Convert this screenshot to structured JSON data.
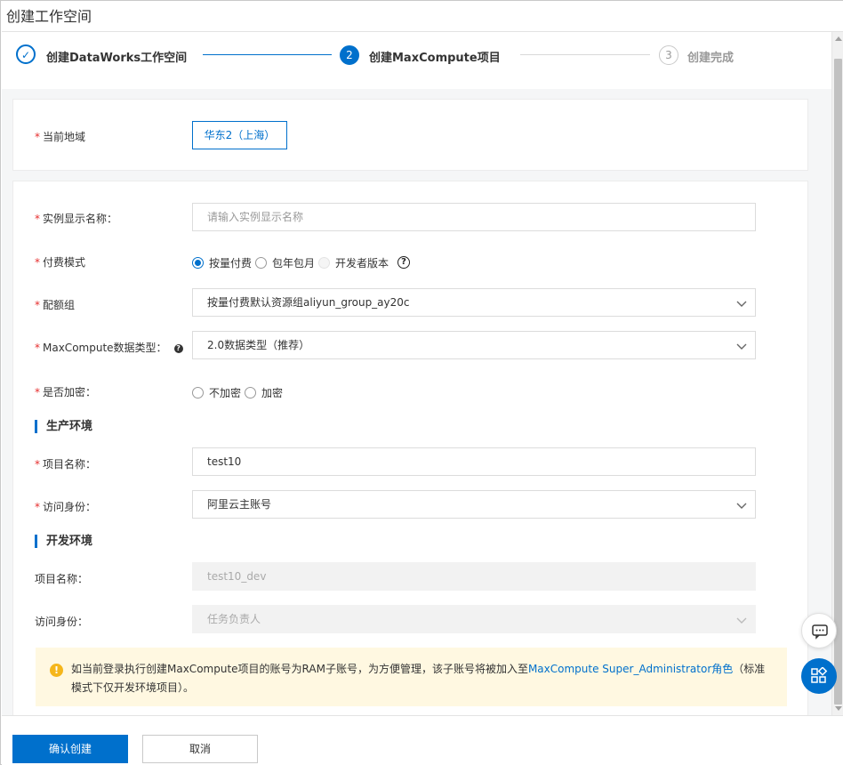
{
  "window": {
    "title": "创建工作空间"
  },
  "steps": [
    {
      "index": "✓",
      "label": "创建DataWorks工作空间",
      "state": "done"
    },
    {
      "index": "2",
      "label": "创建MaxCompute项目",
      "state": "active"
    },
    {
      "index": "3",
      "label": "创建完成",
      "state": "todo"
    }
  ],
  "region": {
    "label": "当前地域",
    "value": "华东2（上海）"
  },
  "form": {
    "instance_name": {
      "label": "实例显示名称：",
      "placeholder": "请输入实例显示名称"
    },
    "billing": {
      "label": "付费模式",
      "options": [
        "按量付费",
        "包年包月",
        "开发者版本"
      ],
      "selected": "按量付费",
      "help_icon": "question-circle-icon"
    },
    "quota_group": {
      "label": "配额组",
      "value": "按量付费默认资源组aliyun_group_ay20c"
    },
    "data_type": {
      "label": "MaxCompute数据类型：",
      "value": "2.0数据类型（推荐）",
      "help_icon": "question-filled-icon"
    },
    "encryption": {
      "label": "是否加密：",
      "options": [
        "不加密",
        "加密"
      ]
    }
  },
  "prod_env": {
    "title": "生产环境",
    "project_name": {
      "label": "项目名称：",
      "value": "test10"
    },
    "access_identity": {
      "label": "访问身份：",
      "value": "阿里云主账号"
    }
  },
  "dev_env": {
    "title": "开发环境",
    "project_name": {
      "label": "项目名称：",
      "value": "test10_dev"
    },
    "access_identity": {
      "label": "访问身份：",
      "value": "任务负责人"
    }
  },
  "notice": {
    "icon": "exclamation-icon",
    "text_before": "如当前登录执行创建MaxCompute项目的账号为RAM子账号，为方便管理，该子账号将被加入至",
    "link": "MaxCompute Super_Administrator角色",
    "text_after": "（标准模式下仅开发环境项目）。"
  },
  "footer": {
    "confirm_label": "确认创建",
    "cancel_label": "取消"
  },
  "floating": {
    "chat_icon": "chat-icon",
    "apps_icon": "apps-grid-icon"
  },
  "colors": {
    "accent": "#0070cc",
    "required": "#e62e2e",
    "notice_bg": "#fff8e1",
    "notice_icon": "#f5b61b"
  }
}
